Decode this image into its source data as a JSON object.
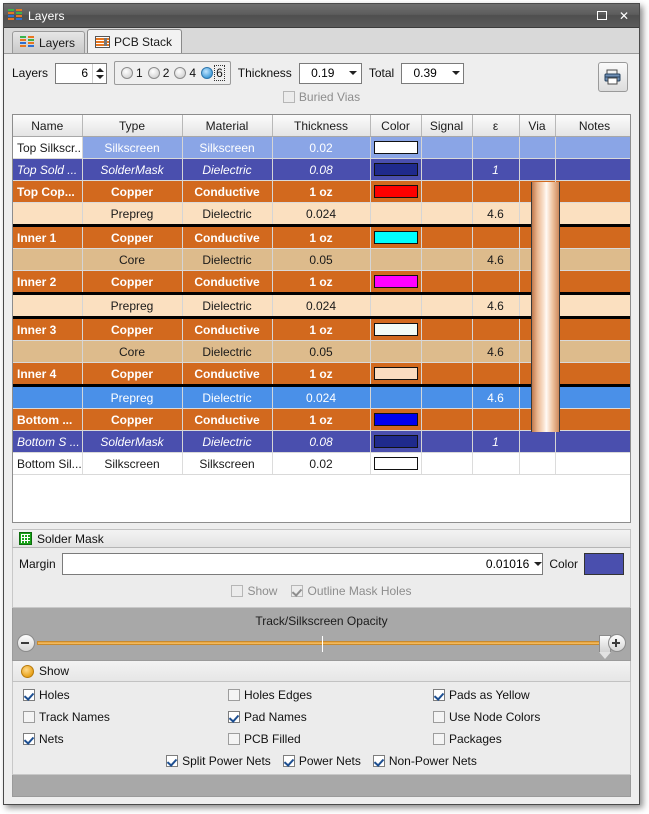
{
  "window": {
    "title": "Layers",
    "icon": "layers-icon",
    "minimize_label": "▭",
    "close_label": "✕"
  },
  "tabs": [
    {
      "label": "Layers",
      "icon": "layers-icon",
      "active": false
    },
    {
      "label": "PCB Stack",
      "icon": "pcb-stack-icon",
      "active": true
    }
  ],
  "toolbar": {
    "layers_label": "Layers",
    "layers_value": "6",
    "layer_count_options": [
      "1",
      "2",
      "4",
      "6"
    ],
    "layer_count_selected": "6",
    "thickness_label": "Thickness",
    "thickness_value": "0.19",
    "total_label": "Total",
    "total_value": "0.39",
    "print_icon": "print-icon",
    "buried_vias_label": "Buried Vias",
    "buried_vias_checked": false
  },
  "table": {
    "columns": [
      "Name",
      "Type",
      "Material",
      "Thickness",
      "Color",
      "Signal",
      "ε",
      "Via",
      "Notes"
    ],
    "rows": [
      {
        "name": "Top Silkscr...",
        "type": "Silkscreen",
        "material": "Silkscreen",
        "thickness": "0.02",
        "color": "#ffffff",
        "signal": "",
        "eps": "",
        "notes": "",
        "style": "silk"
      },
      {
        "name": "Top Sold ...",
        "type": "SolderMask",
        "material": "Dielectric",
        "thickness": "0.08",
        "color": "#1f2a8c",
        "signal": "",
        "eps": "1",
        "notes": "",
        "style": "mask"
      },
      {
        "name": "Top Cop...",
        "type": "Copper",
        "material": "Conductive",
        "thickness": "1 oz",
        "color": "#fc0000",
        "signal": "",
        "eps": "",
        "notes": "",
        "style": "copper"
      },
      {
        "name": "",
        "type": "Prepreg",
        "material": "Dielectric",
        "thickness": "0.024",
        "color": "",
        "signal": "",
        "eps": "4.6",
        "notes": "",
        "style": "prepreg"
      },
      {
        "name": "Inner 1",
        "type": "Copper",
        "material": "Conductive",
        "thickness": "1 oz",
        "color": "#00ffff",
        "signal": "",
        "eps": "",
        "notes": "",
        "style": "copper",
        "group": "top"
      },
      {
        "name": "",
        "type": "Core",
        "material": "Dielectric",
        "thickness": "0.05",
        "color": "",
        "signal": "",
        "eps": "4.6",
        "notes": "",
        "style": "core"
      },
      {
        "name": "Inner 2",
        "type": "Copper",
        "material": "Conductive",
        "thickness": "1 oz",
        "color": "#ff00ff",
        "signal": "",
        "eps": "",
        "notes": "",
        "style": "copper",
        "group": "bottom"
      },
      {
        "name": "",
        "type": "Prepreg",
        "material": "Dielectric",
        "thickness": "0.024",
        "color": "",
        "signal": "",
        "eps": "4.6",
        "notes": "",
        "style": "prepreg"
      },
      {
        "name": "Inner 3",
        "type": "Copper",
        "material": "Conductive",
        "thickness": "1 oz",
        "color": "#f2fbf6",
        "signal": "",
        "eps": "",
        "notes": "",
        "style": "copper",
        "group": "top"
      },
      {
        "name": "",
        "type": "Core",
        "material": "Dielectric",
        "thickness": "0.05",
        "color": "",
        "signal": "",
        "eps": "4.6",
        "notes": "",
        "style": "core"
      },
      {
        "name": "Inner 4",
        "type": "Copper",
        "material": "Conductive",
        "thickness": "1 oz",
        "color": "#fbdcc0",
        "signal": "",
        "eps": "",
        "notes": "",
        "style": "copper",
        "group": "bottom"
      },
      {
        "name": "",
        "type": "Prepreg",
        "material": "Dielectric",
        "thickness": "0.024",
        "color": "",
        "signal": "",
        "eps": "4.6",
        "notes": "",
        "style": "prepregblue"
      },
      {
        "name": "Bottom ...",
        "type": "Copper",
        "material": "Conductive",
        "thickness": "1 oz",
        "color": "#0000ee",
        "signal": "",
        "eps": "",
        "notes": "",
        "style": "copper"
      },
      {
        "name": "Bottom S ...",
        "type": "SolderMask",
        "material": "Dielectric",
        "thickness": "0.08",
        "color": "#1f2a8c",
        "signal": "",
        "eps": "1",
        "notes": "",
        "style": "mask"
      },
      {
        "name": "Bottom Sil...",
        "type": "Silkscreen",
        "material": "Silkscreen",
        "thickness": "0.02",
        "color": "#ffffff",
        "signal": "",
        "eps": "",
        "notes": "",
        "style": "silkw"
      }
    ]
  },
  "solder_mask": {
    "panel_title": "Solder Mask",
    "panel_icon": "mask-grid-icon",
    "margin_label": "Margin",
    "margin_value": "0.01016",
    "color_label": "Color",
    "color_value": "#4a4fae",
    "show_label": "Show",
    "show_checked": false,
    "outline_mask_holes_label": "Outline Mask Holes",
    "outline_mask_holes_checked": true
  },
  "opacity": {
    "title": "Track/Silkscreen Opacity",
    "minus_icon": "minus-icon",
    "plus_icon": "plus-icon",
    "value_percent": 100
  },
  "show_panel": {
    "title": "Show",
    "icon": "show-bulb-icon",
    "items": [
      {
        "label": "Holes",
        "checked": true
      },
      {
        "label": "Holes Edges",
        "checked": false
      },
      {
        "label": "Pads as Yellow",
        "checked": true
      },
      {
        "label": "Track Names",
        "checked": false
      },
      {
        "label": "Pad Names",
        "checked": true
      },
      {
        "label": "Use Node Colors",
        "checked": false
      },
      {
        "label": "Nets",
        "checked": true
      },
      {
        "label": "PCB Filled",
        "checked": false
      },
      {
        "label": "Packages",
        "checked": false
      }
    ],
    "net_items": [
      {
        "label": "Split Power Nets",
        "checked": true
      },
      {
        "label": "Power Nets",
        "checked": true
      },
      {
        "label": "Non-Power Nets",
        "checked": true
      }
    ]
  },
  "colors": {
    "copper_row": "#d2691e",
    "prepreg_row": "#fbe0c0",
    "core_row": "#ddbb8c",
    "silkscreen_row": "#8aa5e6",
    "soldermask_row": "#4a4fae",
    "prepreg_blue_row": "#4a90e8",
    "accent": "#e8a33d"
  }
}
